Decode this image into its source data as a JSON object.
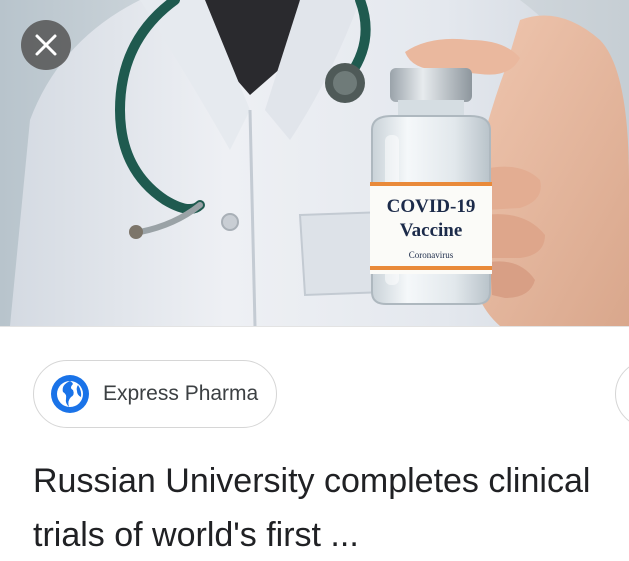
{
  "image_card": {
    "photo_alt": "Doctor holding a COVID-19 vaccine vial",
    "vial_label": {
      "line1": "COVID-19",
      "line2": "Vaccine",
      "line3": "Coronavirus"
    },
    "close_icon": "close-icon"
  },
  "source": {
    "name": "Express Pharma",
    "icon": "globe-icon",
    "icon_color": "#1a73e8"
  },
  "headline": {
    "line1": "Russian University completes clinical",
    "line2": "trials of world's first ..."
  }
}
